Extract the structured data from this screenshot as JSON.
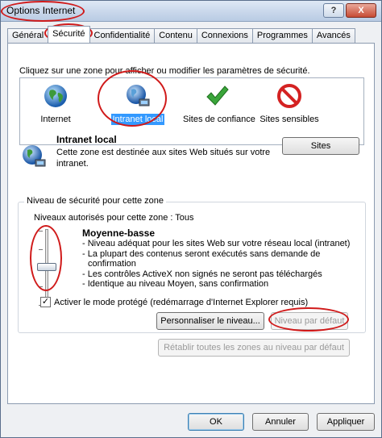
{
  "window": {
    "title": "Options Internet"
  },
  "titlebar_buttons": {
    "help": "?",
    "close": "X"
  },
  "tabs": [
    {
      "label": "Général"
    },
    {
      "label": "Sécurité"
    },
    {
      "label": "Confidentialité"
    },
    {
      "label": "Contenu"
    },
    {
      "label": "Connexions"
    },
    {
      "label": "Programmes"
    },
    {
      "label": "Avancés"
    }
  ],
  "security": {
    "zone_prompt": "Cliquez sur une zone pour afficher ou modifier les paramètres de sécurité.",
    "zones": [
      {
        "label": "Internet",
        "icon": "globe-icon"
      },
      {
        "label": "Intranet local",
        "icon": "intranet-globe-icon",
        "selected": true
      },
      {
        "label": "Sites de confiance",
        "icon": "checkmark-icon"
      },
      {
        "label": "Sites sensibles",
        "icon": "no-entry-icon"
      }
    ],
    "zone_info": {
      "title": "Intranet local",
      "description": "Cette zone est destinée aux sites Web situés sur votre intranet."
    },
    "sites_button": "Sites",
    "level_group_title": "Niveau de sécurité pour cette zone",
    "allowed_levels": "Niveaux autorisés pour cette zone : Tous",
    "slider_level_fraction": 0.45,
    "level_name": "Moyenne-basse",
    "level_description": [
      "- Niveau adéquat pour les sites Web sur votre réseau local (intranet)",
      "- La plupart des contenus seront exécutés sans demande de",
      "  confirmation",
      "- Les contrôles ActiveX non signés ne seront pas téléchargés",
      "- Identique au niveau Moyen, sans confirmation"
    ],
    "protected_mode_label": "Activer le mode protégé (redémarrage d'Internet Explorer requis)",
    "protected_mode_checked": true,
    "custom_level_button": "Personnaliser le niveau...",
    "default_level_button": "Niveau par défaut",
    "reset_all_button": "Rétablir toutes les zones au niveau par défaut"
  },
  "footer": {
    "ok": "OK",
    "cancel": "Annuler",
    "apply": "Appliquer"
  },
  "colors": {
    "annotation": "#d01a1a",
    "selection": "#3399ff"
  }
}
